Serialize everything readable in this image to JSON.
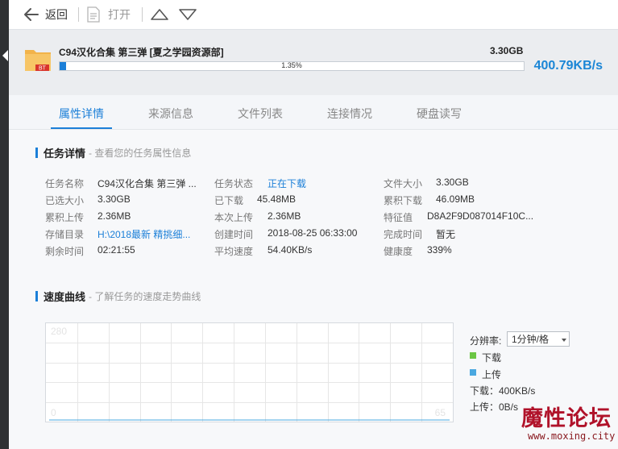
{
  "toolbar": {
    "back_label": "返回",
    "open_label": "打开"
  },
  "task": {
    "title": "C94汉化合集 第三弹 [夏之学园资源部]",
    "size": "3.30GB",
    "progress_text": "1.35%",
    "progress_fraction": 0.0135,
    "speed": "400.79KB/s",
    "icon_badge": "BT"
  },
  "tabs": [
    {
      "label": "属性详情",
      "active": true
    },
    {
      "label": "来源信息",
      "active": false
    },
    {
      "label": "文件列表",
      "active": false
    },
    {
      "label": "连接情况",
      "active": false
    },
    {
      "label": "硬盘读写",
      "active": false
    }
  ],
  "details": {
    "title": "任务详情",
    "subtitle": "- 查看您的任务属性信息",
    "rows": [
      [
        {
          "label": "任务名称",
          "value": "C94汉化合集 第三弹 ..."
        },
        {
          "label": "任务状态",
          "value": "正在下载",
          "link": true
        },
        {
          "label": "文件大小",
          "value": "3.30GB"
        }
      ],
      [
        {
          "label": "已选大小",
          "value": "3.30GB"
        },
        {
          "label": "已下载",
          "value": "45.48MB"
        },
        {
          "label": "累积下载",
          "value": "46.09MB"
        }
      ],
      [
        {
          "label": "累积上传",
          "value": "2.36MB"
        },
        {
          "label": "本次上传",
          "value": "2.36MB"
        },
        {
          "label": "特征值",
          "value": "D8A2F9D087014F10C..."
        }
      ],
      [
        {
          "label": "存储目录",
          "value": "H:\\2018最新 精挑细...",
          "link": true
        },
        {
          "label": "创建时间",
          "value": "2018-08-25 06:33:00"
        },
        {
          "label": "完成时间",
          "value": "暂无"
        }
      ],
      [
        {
          "label": "剩余时间",
          "value": "02:21:55"
        },
        {
          "label": "平均速度",
          "value": "54.40KB/s"
        },
        {
          "label": "健康度",
          "value": "339%"
        }
      ]
    ]
  },
  "speed_curve": {
    "title": "速度曲线",
    "subtitle": "- 了解任务的速度走势曲线",
    "y_max_label": "280",
    "y_min_label": "0",
    "x_right_label": "65",
    "resolution_label": "分辨率:",
    "resolution_value": "1分钟/格",
    "legend_download": "下载",
    "legend_upload": "上传",
    "download_rate": "下载：400KB/s",
    "upload_rate": "上传：0B/s",
    "colors": {
      "download": "#6cc644",
      "upload": "#4aa8e0",
      "grid": "#e6e6e6"
    }
  },
  "chart_data": {
    "type": "line",
    "title": "",
    "xlabel": "",
    "ylabel": "",
    "ylim": [
      0,
      280
    ],
    "x": [
      0,
      1,
      2,
      3,
      4,
      5,
      6,
      7,
      8,
      9,
      10,
      11,
      12
    ],
    "series": [
      {
        "name": "下载",
        "values": [
          0,
          0,
          0,
          0,
          0,
          0,
          0,
          0,
          0,
          0,
          0,
          0,
          0
        ]
      },
      {
        "name": "上传",
        "values": [
          0,
          0,
          0,
          0,
          0,
          0,
          0,
          0,
          0,
          0,
          0,
          0,
          0
        ]
      }
    ],
    "grid": true
  },
  "watermark": {
    "text": "魔性论坛",
    "url": "www.moxing.city"
  }
}
